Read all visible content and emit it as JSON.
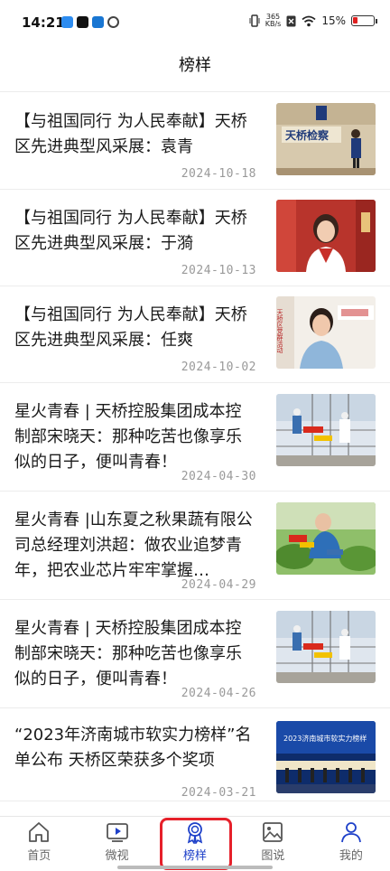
{
  "status": {
    "time": "14:21",
    "net_speed_value": "365",
    "net_speed_unit": "KB/s",
    "battery": "15%"
  },
  "header": {
    "title": "榜样"
  },
  "news": [
    {
      "title": "【与祖国同行  为人民奉献】天桥区先进典型风采展：袁青",
      "date": "2024-10-18"
    },
    {
      "title": "【与祖国同行  为人民奉献】天桥区先进典型风采展：于漪",
      "date": "2024-10-13"
    },
    {
      "title": "【与祖国同行  为人民奉献】天桥区先进典型风采展：任爽",
      "date": "2024-10-02"
    },
    {
      "title": "星火青春  |  天桥控股集团成本控制部宋晓天：那种吃苦也像享乐似的日子，便叫青春！",
      "date": "2024-04-30"
    },
    {
      "title": "星火青春  |山东夏之秋果蔬有限公司总经理刘洪超：做农业追梦青年，把农业芯片牢牢掌握…",
      "date": "2024-04-29"
    },
    {
      "title": "星火青春  |  天桥控股集团成本控制部宋晓天：那种吃苦也像享乐似的日子，便叫青春！",
      "date": "2024-04-26"
    },
    {
      "title": "“2023年济南城市软实力榜样”名单公布  天桥区荣获多个奖项",
      "date": "2024-03-21"
    }
  ],
  "thumb_texts": {
    "sign": "天桥检察",
    "banner": "天桥区党群活动",
    "screen": "2023济南城市软实力榜样"
  },
  "tabs": [
    {
      "label": "首页",
      "icon": "home-icon"
    },
    {
      "label": "微视",
      "icon": "video-icon"
    },
    {
      "label": "榜样",
      "icon": "medal-icon",
      "active": true
    },
    {
      "label": "图说",
      "icon": "image-icon"
    },
    {
      "label": "我的",
      "icon": "person-icon"
    }
  ],
  "colors": {
    "accent": "#1e40c9",
    "highlight_ring": "#e6202a",
    "date": "#999999"
  }
}
